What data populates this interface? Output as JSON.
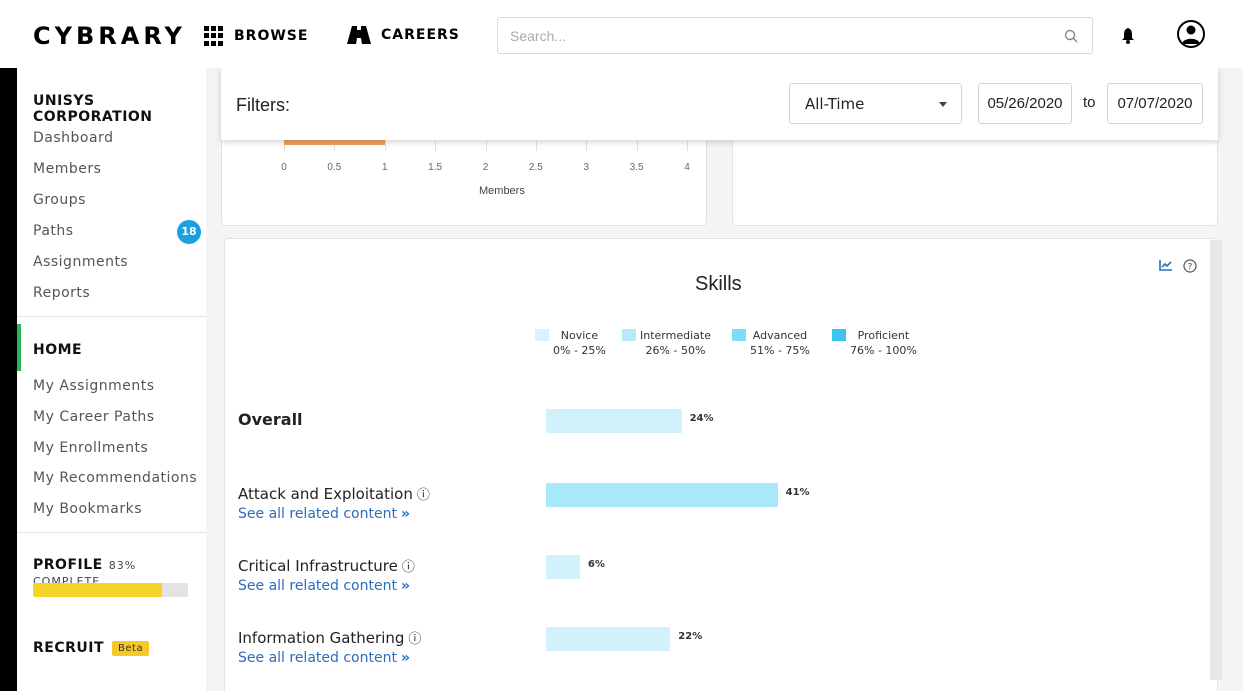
{
  "brand": {
    "logo": "CYBRARY"
  },
  "nav": {
    "browse": "BROWSE",
    "careers": "CAREERS"
  },
  "search": {
    "placeholder": "Search..."
  },
  "sidebar": {
    "org": "UNISYS CORPORATION",
    "admin_links": [
      "Dashboard",
      "Members",
      "Groups",
      "Paths",
      "Assignments",
      "Reports"
    ],
    "paths_badge": "18",
    "home": "HOME",
    "home_links": [
      "My Assignments",
      "My Career Paths",
      "My Enrollments",
      "My Recommendations",
      "My Bookmarks"
    ],
    "profile": {
      "label": "PROFILE",
      "complete_text": "83% COMPLETE",
      "progress_pct": 83
    },
    "recruit": {
      "label": "RECRUIT",
      "badge": "Beta"
    }
  },
  "filters": {
    "label": "Filters:",
    "range_select": "All-Time",
    "start_date": "05/26/2020",
    "to": "to",
    "end_date": "07/07/2020"
  },
  "members_chart": {
    "ticks": [
      "0",
      "0.5",
      "1",
      "1.5",
      "2",
      "2.5",
      "3",
      "3.5",
      "4"
    ],
    "axis_title": "Members",
    "bar_value": 1,
    "max": 4,
    "bar_color": "#f0a25a"
  },
  "skills": {
    "title": "Skills",
    "legend": [
      {
        "name": "Novice",
        "range": "0% - 25%",
        "color": "#d8f3fb"
      },
      {
        "name": "Intermediate",
        "range": "26% - 50%",
        "color": "#b5ebf9"
      },
      {
        "name": "Advanced",
        "range": "51% - 75%",
        "color": "#7fdcf4"
      },
      {
        "name": "Proficient",
        "range": "76% - 100%",
        "color": "#3ec4ec"
      }
    ],
    "see_all": "See all related content",
    "rows": [
      {
        "name": "Overall",
        "pct_label": "24%",
        "value": 24,
        "color": "#d2f2fb"
      },
      {
        "name": "Attack and Exploitation",
        "pct_label": "41%",
        "value": 41,
        "color": "#a8e8f8"
      },
      {
        "name": "Critical Infrastructure",
        "pct_label": "6%",
        "value": 6,
        "color": "#d2f2fb"
      },
      {
        "name": "Information Gathering",
        "pct_label": "22%",
        "value": 22,
        "color": "#d2f2fb"
      }
    ]
  }
}
